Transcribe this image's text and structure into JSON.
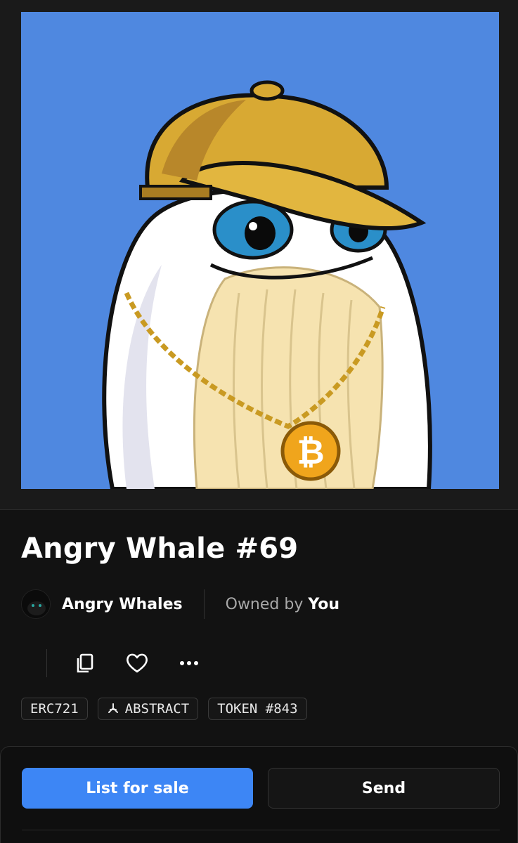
{
  "nft": {
    "title": "Angry Whale #69",
    "image_icon": "angry-whale-artwork",
    "colors": {
      "background": "#4f88e0",
      "cap": "#d8a933",
      "coin": "#f0a51c"
    }
  },
  "collection": {
    "name": "Angry Whales",
    "avatar_icon": "whale-avatar-icon"
  },
  "owner": {
    "label": "Owned by",
    "value": "You"
  },
  "actions": [
    {
      "name": "copy",
      "icon": "copy-icon"
    },
    {
      "name": "favorite",
      "icon": "heart-icon"
    },
    {
      "name": "more",
      "icon": "more-horizontal-icon"
    }
  ],
  "tags": {
    "standard": "ERC721",
    "chain": "ABSTRACT",
    "chain_icon": "abstract-chain-icon",
    "token": "TOKEN #843"
  },
  "buttons": {
    "list_for_sale": "List for sale",
    "send": "Send"
  },
  "colors": {
    "accent": "#3d86f5",
    "background": "#121212"
  }
}
